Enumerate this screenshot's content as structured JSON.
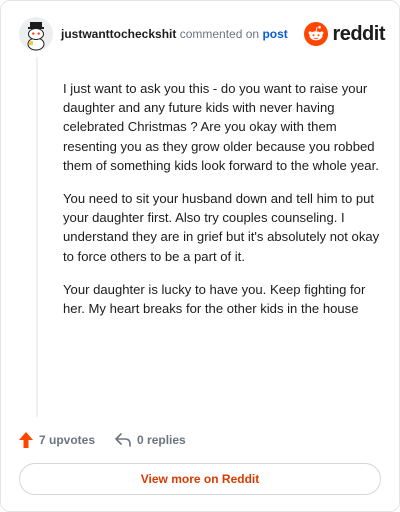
{
  "comment": {
    "username": "justwanttocheckshit",
    "action_text": "commented on",
    "post_link": "post",
    "paragraphs": [
      "I just want to ask you this - do you want to raise your daughter and any future kids with never having celebrated Christmas ? Are you okay with them resenting you as they grow older because you robbed them of something kids look forward to the whole year.",
      "You need to sit your husband down and tell him to put your daughter first. Also try couples counseling. I understand they are in grief but it's absolutely not okay to force others to be a part of it.",
      "Your daughter is lucky to have you. Keep fighting for her. My heart breaks for the other kids in the house"
    ],
    "upvotes": "7 upvotes",
    "replies": "0 replies"
  },
  "brand": {
    "name": "reddit",
    "accent": "#ff4500"
  },
  "footer": {
    "view_label": "View more on Reddit"
  },
  "icons": {
    "avatar": "snoo-avatar-icon",
    "logo": "reddit-logo-icon",
    "upvote": "upvote-arrow-icon",
    "reply": "reply-arrow-icon"
  },
  "colors": {
    "username": "#1c1c1c",
    "link": "#0a5bd7",
    "button_text": "#d93a00",
    "upvote": "#ff4500"
  }
}
